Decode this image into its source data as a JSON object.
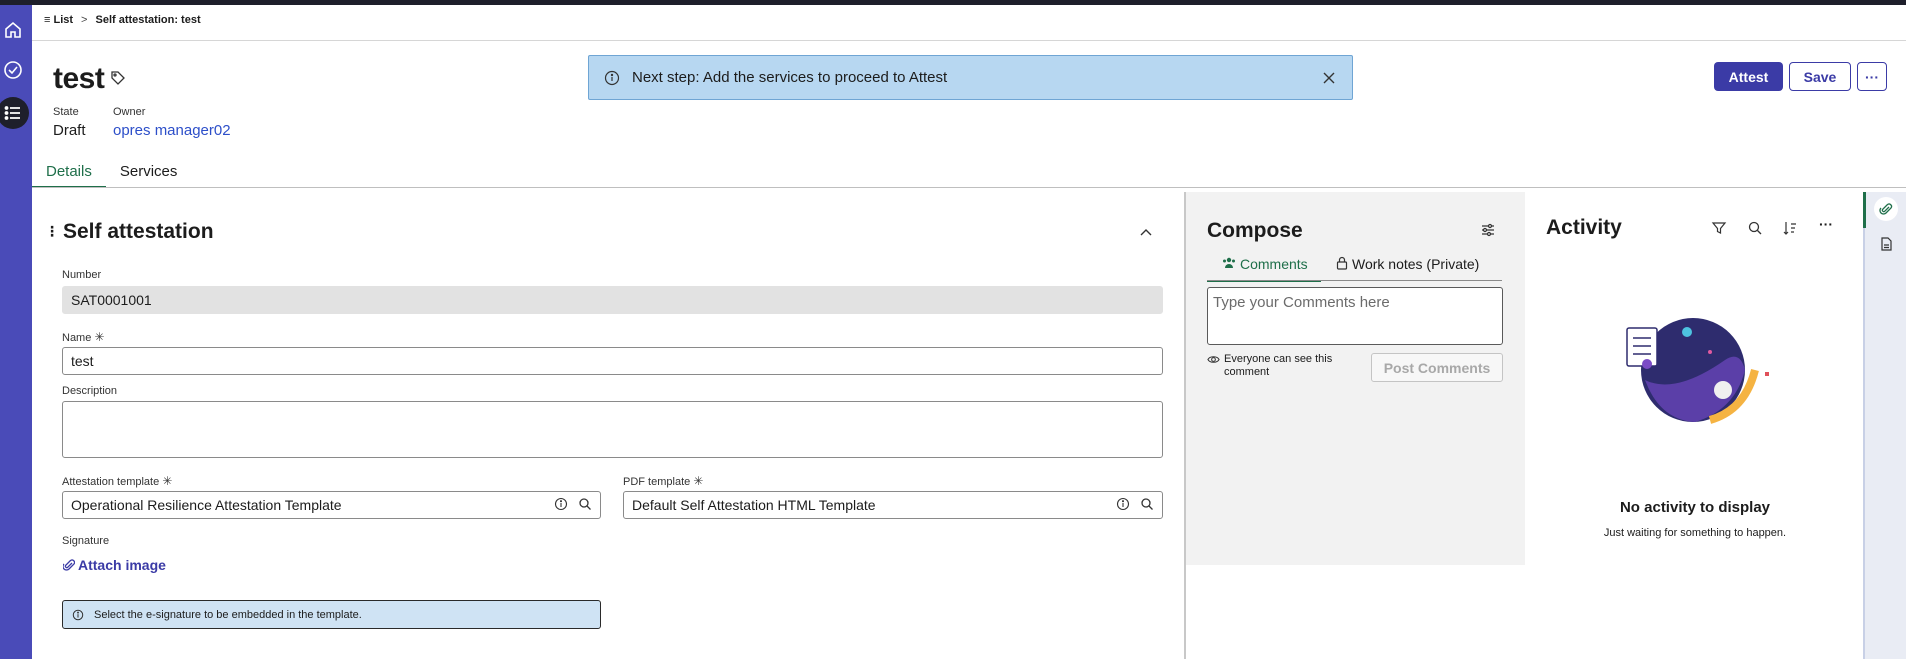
{
  "breadcrumb": {
    "list_label": "List",
    "separator": ">",
    "current": "Self attestation: test"
  },
  "record": {
    "title": "test",
    "state_label": "State",
    "state_value": "Draft",
    "owner_label": "Owner",
    "owner_value": "opres manager02"
  },
  "toast": {
    "message": "Next step: Add the services to proceed to Attest"
  },
  "actions": {
    "attest": "Attest",
    "save": "Save",
    "more": "···"
  },
  "tabs": [
    {
      "label": "Details",
      "active": true
    },
    {
      "label": "Services",
      "active": false
    }
  ],
  "form": {
    "section_title": "Self attestation",
    "number_label": "Number",
    "number_value": "SAT0001001",
    "name_label": "Name",
    "name_value": "test",
    "required_mark": "✳",
    "description_label": "Description",
    "description_value": "",
    "attestation_template_label": "Attestation template",
    "attestation_template_value": "Operational Resilience Attestation Template",
    "pdf_template_label": "PDF template",
    "pdf_template_value": "Default Self Attestation HTML Template",
    "signature_label": "Signature",
    "attach_label": "Attach image",
    "note": "Select the e-signature to be embedded in the template."
  },
  "compose": {
    "title": "Compose",
    "tab_comments": "Comments",
    "tab_worknotes": "Work notes (Private)",
    "placeholder": "Type your Comments here",
    "visibility": "Everyone can see this comment",
    "post_button": "Post Comments"
  },
  "activity": {
    "title": "Activity",
    "empty_title": "No activity to display",
    "empty_sub": "Just waiting for something to happen."
  },
  "icons": [
    "home-icon",
    "check-circle-icon",
    "list-icon",
    "tag-icon",
    "info-icon",
    "close-icon",
    "chevron-up-icon",
    "search-icon",
    "filter-icon",
    "sort-icon",
    "paperclip-icon",
    "document-icon",
    "eye-icon",
    "lock-icon",
    "settings-sliders-icon",
    "users-icon"
  ],
  "colors": {
    "primary": "#3b3ba6",
    "nav": "#4a4bb8",
    "accent_green": "#1f6f4a",
    "toast_bg": "#b7d7f1",
    "note_bg": "#cfe3f4"
  }
}
